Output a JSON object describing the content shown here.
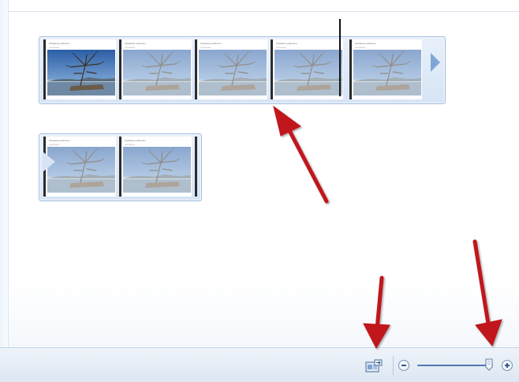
{
  "storyboard": {
    "groups": [
      {
        "frames": [
          {
            "caption": "Название рабочего",
            "sub": "описание",
            "faded": false
          },
          {
            "caption": "Название рабочего",
            "sub": "описание",
            "faded": true
          },
          {
            "caption": "Название рабочего",
            "sub": "описание",
            "faded": true
          },
          {
            "caption": "Название рабочего",
            "sub": "описание",
            "faded": true
          },
          {
            "caption": "Название рабочего",
            "sub": "описание",
            "faded": true
          }
        ]
      },
      {
        "frames": [
          {
            "caption": "Название рабочего",
            "sub": "описание",
            "faded": true
          },
          {
            "caption": "Название рабочего",
            "sub": "описание",
            "faded": true
          }
        ]
      }
    ]
  },
  "status_bar": {
    "fit_icon": "fit-to-window-icon",
    "zoom_out_icon": "zoom-out-icon",
    "zoom_in_icon": "zoom-in-icon",
    "zoom_level": 0.95
  },
  "colors": {
    "accent": "#4c79b3",
    "annotation": "#c0161d",
    "group_border": "#9fbde0"
  }
}
